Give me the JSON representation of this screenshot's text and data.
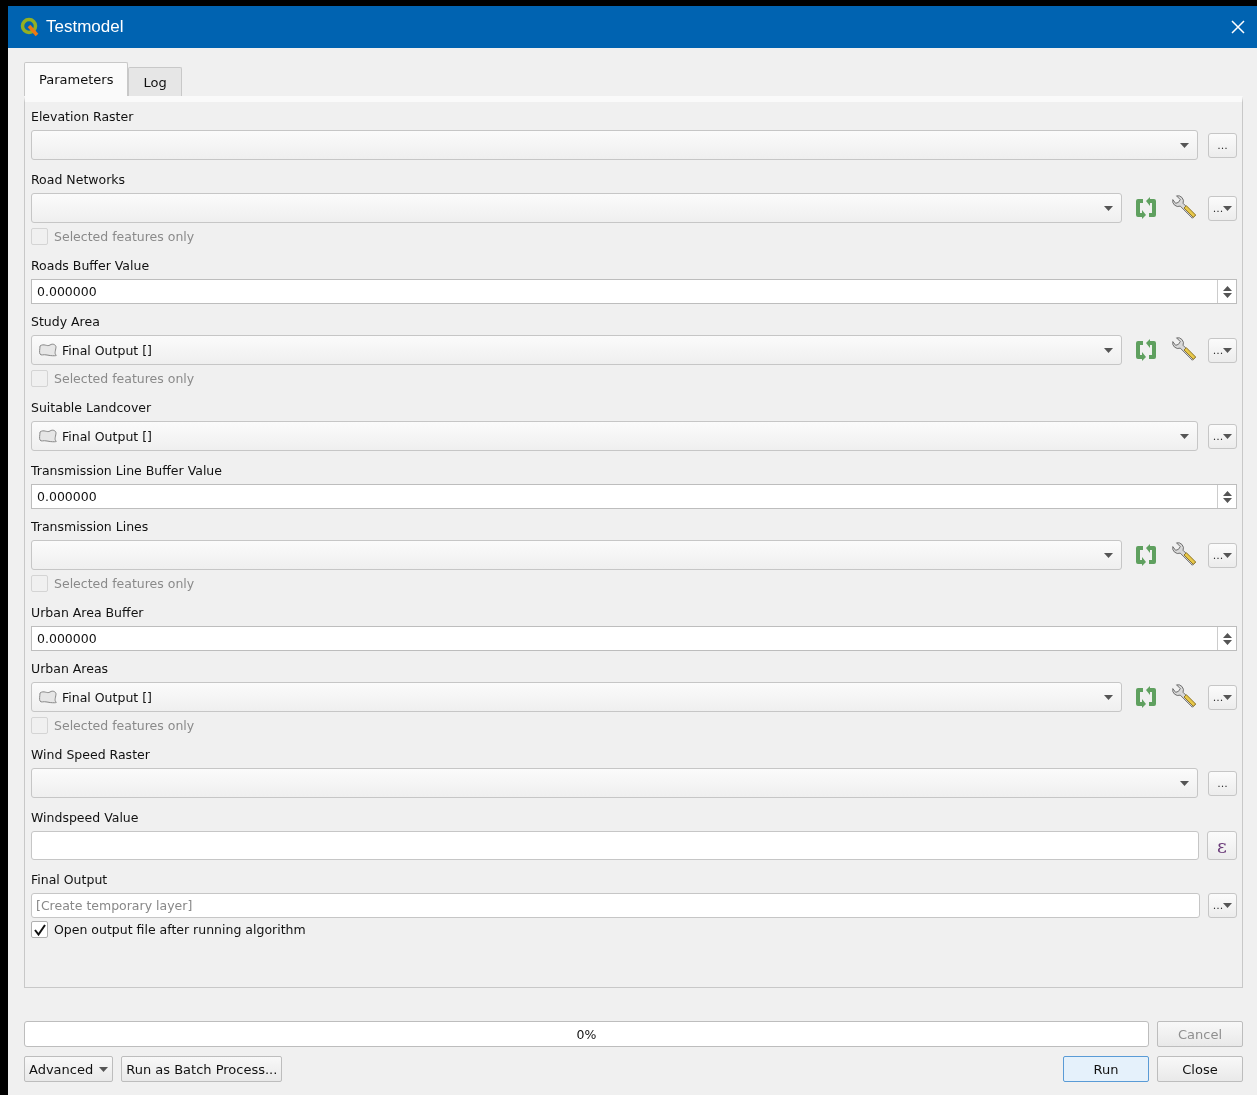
{
  "window": {
    "title": "Testmodel"
  },
  "tabs": [
    {
      "label": "Parameters",
      "selected": true
    },
    {
      "label": "Log",
      "selected": false
    }
  ],
  "parameters": [
    {
      "kind": "raster",
      "label": "Elevation Raster",
      "browse": "..."
    },
    {
      "kind": "vector",
      "label": "Road Networks",
      "browse": "...",
      "selected_only": {
        "label": "Selected features only",
        "checked": false,
        "disabled": true
      }
    },
    {
      "kind": "number",
      "label": "Roads Buffer Value",
      "value": "0.000000"
    },
    {
      "kind": "vector",
      "label": "Study Area",
      "value": "Final Output []",
      "browse": "...",
      "selected_only": {
        "label": "Selected features only",
        "checked": false,
        "disabled": true
      }
    },
    {
      "kind": "layer",
      "label": "Suitable Landcover",
      "value": "Final Output []",
      "browse": "..."
    },
    {
      "kind": "number",
      "label": "Transmission Line Buffer Value",
      "value": "0.000000"
    },
    {
      "kind": "vector",
      "label": "Transmission Lines",
      "browse": "...",
      "selected_only": {
        "label": "Selected features only",
        "checked": false,
        "disabled": true
      }
    },
    {
      "kind": "number",
      "label": "Urban Area Buffer",
      "value": "0.000000"
    },
    {
      "kind": "vector",
      "label": "Urban Areas",
      "value": "Final Output []",
      "browse": "...",
      "selected_only": {
        "label": "Selected features only",
        "checked": false,
        "disabled": true
      }
    },
    {
      "kind": "raster",
      "label": "Wind Speed Raster",
      "browse": "..."
    },
    {
      "kind": "expression",
      "label": "Windspeed Value",
      "button": "ε"
    },
    {
      "kind": "output",
      "label": "Final Output",
      "placeholder": "[Create temporary layer]",
      "browse": "...",
      "open_after": {
        "label": "Open output file after running algorithm",
        "checked": true,
        "disabled": false
      }
    }
  ],
  "progress": {
    "level": 0,
    "text": "0%"
  },
  "cancel": {
    "label": "Cancel",
    "disabled": true
  },
  "left_buttons": [
    {
      "kind": "menu",
      "label": "Advanced"
    },
    {
      "kind": "plain",
      "label": "Run as Batch Process..."
    }
  ],
  "right_buttons": [
    {
      "label": "Run",
      "default": true
    },
    {
      "label": "Close",
      "default": false
    }
  ]
}
